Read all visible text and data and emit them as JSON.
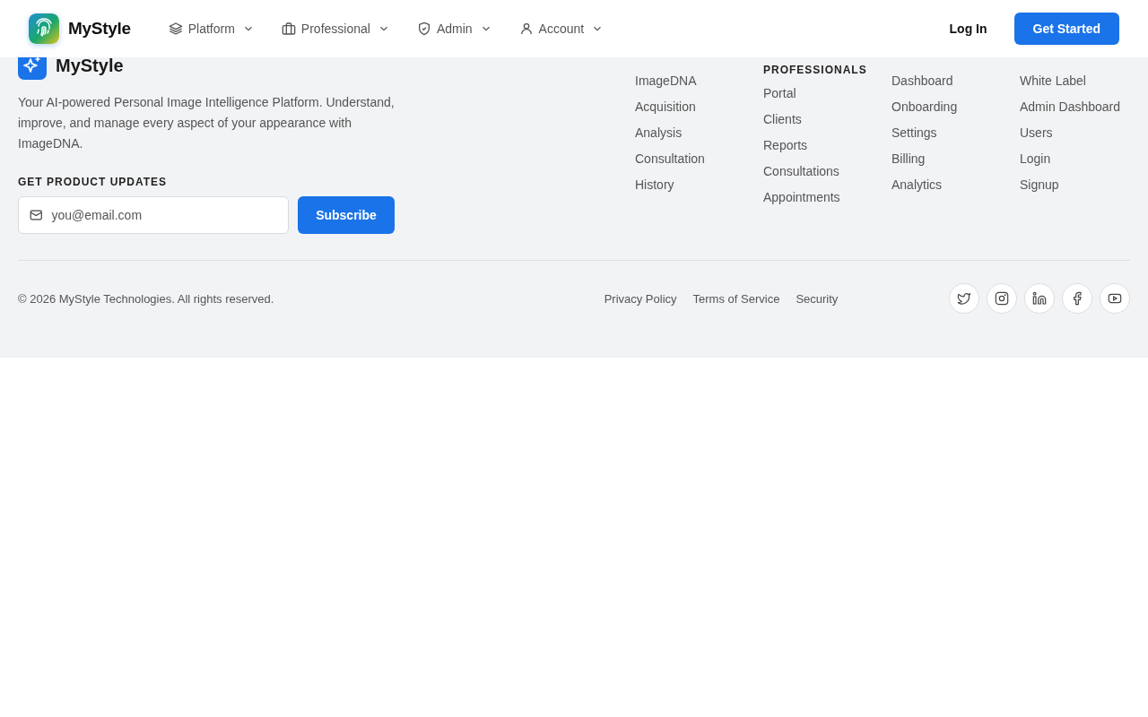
{
  "header": {
    "brand": "MyStyle",
    "nav": [
      {
        "label": "Platform"
      },
      {
        "label": "Professional"
      },
      {
        "label": "Admin"
      },
      {
        "label": "Account"
      }
    ],
    "login": "Log In",
    "cta": "Get Started"
  },
  "footer": {
    "brand": "MyStyle",
    "description": "Your AI-powered Personal Image Intelligence Platform. Understand, improve, and manage every aspect of your appearance with ImageDNA.",
    "updates_title": "GET PRODUCT UPDATES",
    "email": {
      "placeholder": "you@email.com"
    },
    "subscribe": "Subscribe",
    "columns": [
      {
        "links": [
          "ImageDNA",
          "Acquisition",
          "Analysis",
          "Consultation",
          "History"
        ]
      },
      {
        "title": "PROFESSIONALS",
        "links": [
          "Portal",
          "Clients",
          "Reports",
          "Consultations",
          "Appointments"
        ]
      },
      {
        "links": [
          "Dashboard",
          "Onboarding",
          "Settings",
          "Billing",
          "Analytics"
        ]
      },
      {
        "links": [
          "White Label",
          "Admin Dashboard",
          "Users",
          "Login",
          "Signup"
        ]
      }
    ],
    "copyright": "© 2026 MyStyle Technologies. All rights reserved.",
    "legal": [
      "Privacy Policy",
      "Terms of Service",
      "Security"
    ],
    "social": [
      {
        "kind": "twitter"
      },
      {
        "kind": "instagram"
      },
      {
        "kind": "linkedin"
      },
      {
        "kind": "facebook"
      },
      {
        "kind": "youtube"
      }
    ]
  }
}
